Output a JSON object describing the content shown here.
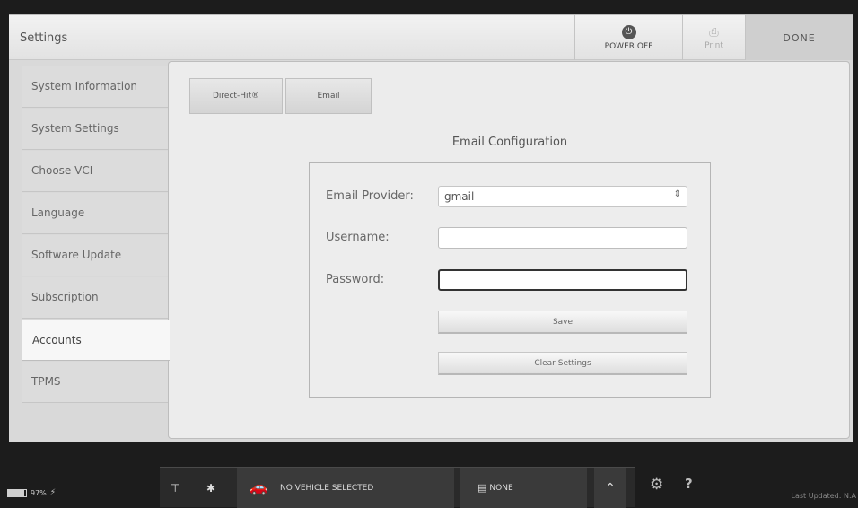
{
  "header": {
    "title": "Settings",
    "power_label": "POWER OFF",
    "print_label": "Print",
    "done_label": "DONE",
    "power_icon": "⏻",
    "print_icon": "⎙"
  },
  "sidebar": {
    "items": [
      {
        "label": "System Information"
      },
      {
        "label": "System Settings"
      },
      {
        "label": "Choose VCI"
      },
      {
        "label": "Language"
      },
      {
        "label": "Software Update"
      },
      {
        "label": "Subscription"
      },
      {
        "label": "Accounts",
        "active": true
      },
      {
        "label": "TPMS"
      }
    ]
  },
  "tabs": [
    {
      "label": "Direct-Hit®"
    },
    {
      "label": "Email"
    }
  ],
  "email_config": {
    "title": "Email Configuration",
    "provider_label": "Email Provider:",
    "provider_value": "gmail",
    "username_label": "Username:",
    "username_value": "",
    "password_label": "Password:",
    "password_value": "",
    "save_label": "Save",
    "clear_label": "Clear Settings"
  },
  "status_bar": {
    "battery_text": "97%",
    "vehicle_text": "NO VEHICLE SELECTED",
    "vci_text": "NONE",
    "last_updated": "Last Updated: N.A"
  }
}
